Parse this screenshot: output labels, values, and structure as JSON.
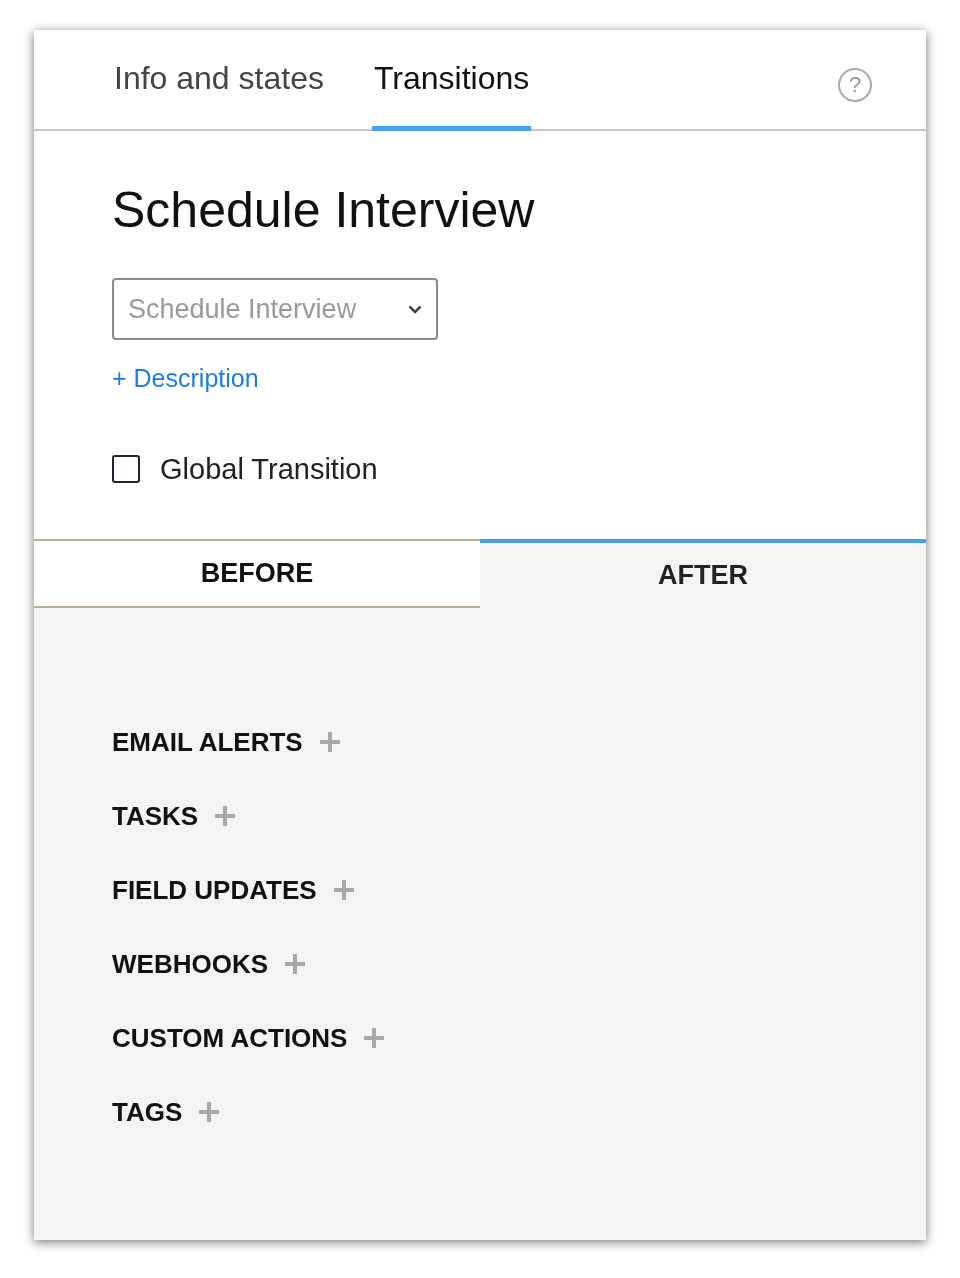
{
  "tabs": [
    {
      "label": "Info and states",
      "selected": false
    },
    {
      "label": "Transitions",
      "selected": true
    }
  ],
  "help": {
    "symbol": "?"
  },
  "title": "Schedule Interview",
  "dropdown": {
    "placeholder": "Schedule Interview"
  },
  "description_link": "+ Description",
  "global_transition": {
    "label": "Global Transition",
    "checked": false
  },
  "subtabs": [
    {
      "label": "BEFORE",
      "selected": false
    },
    {
      "label": "AFTER",
      "selected": true
    }
  ],
  "sections": [
    {
      "label": "EMAIL ALERTS"
    },
    {
      "label": "TASKS"
    },
    {
      "label": "FIELD UPDATES"
    },
    {
      "label": "WEBHOOKS"
    },
    {
      "label": "CUSTOM ACTIONS"
    },
    {
      "label": "TAGS"
    }
  ]
}
